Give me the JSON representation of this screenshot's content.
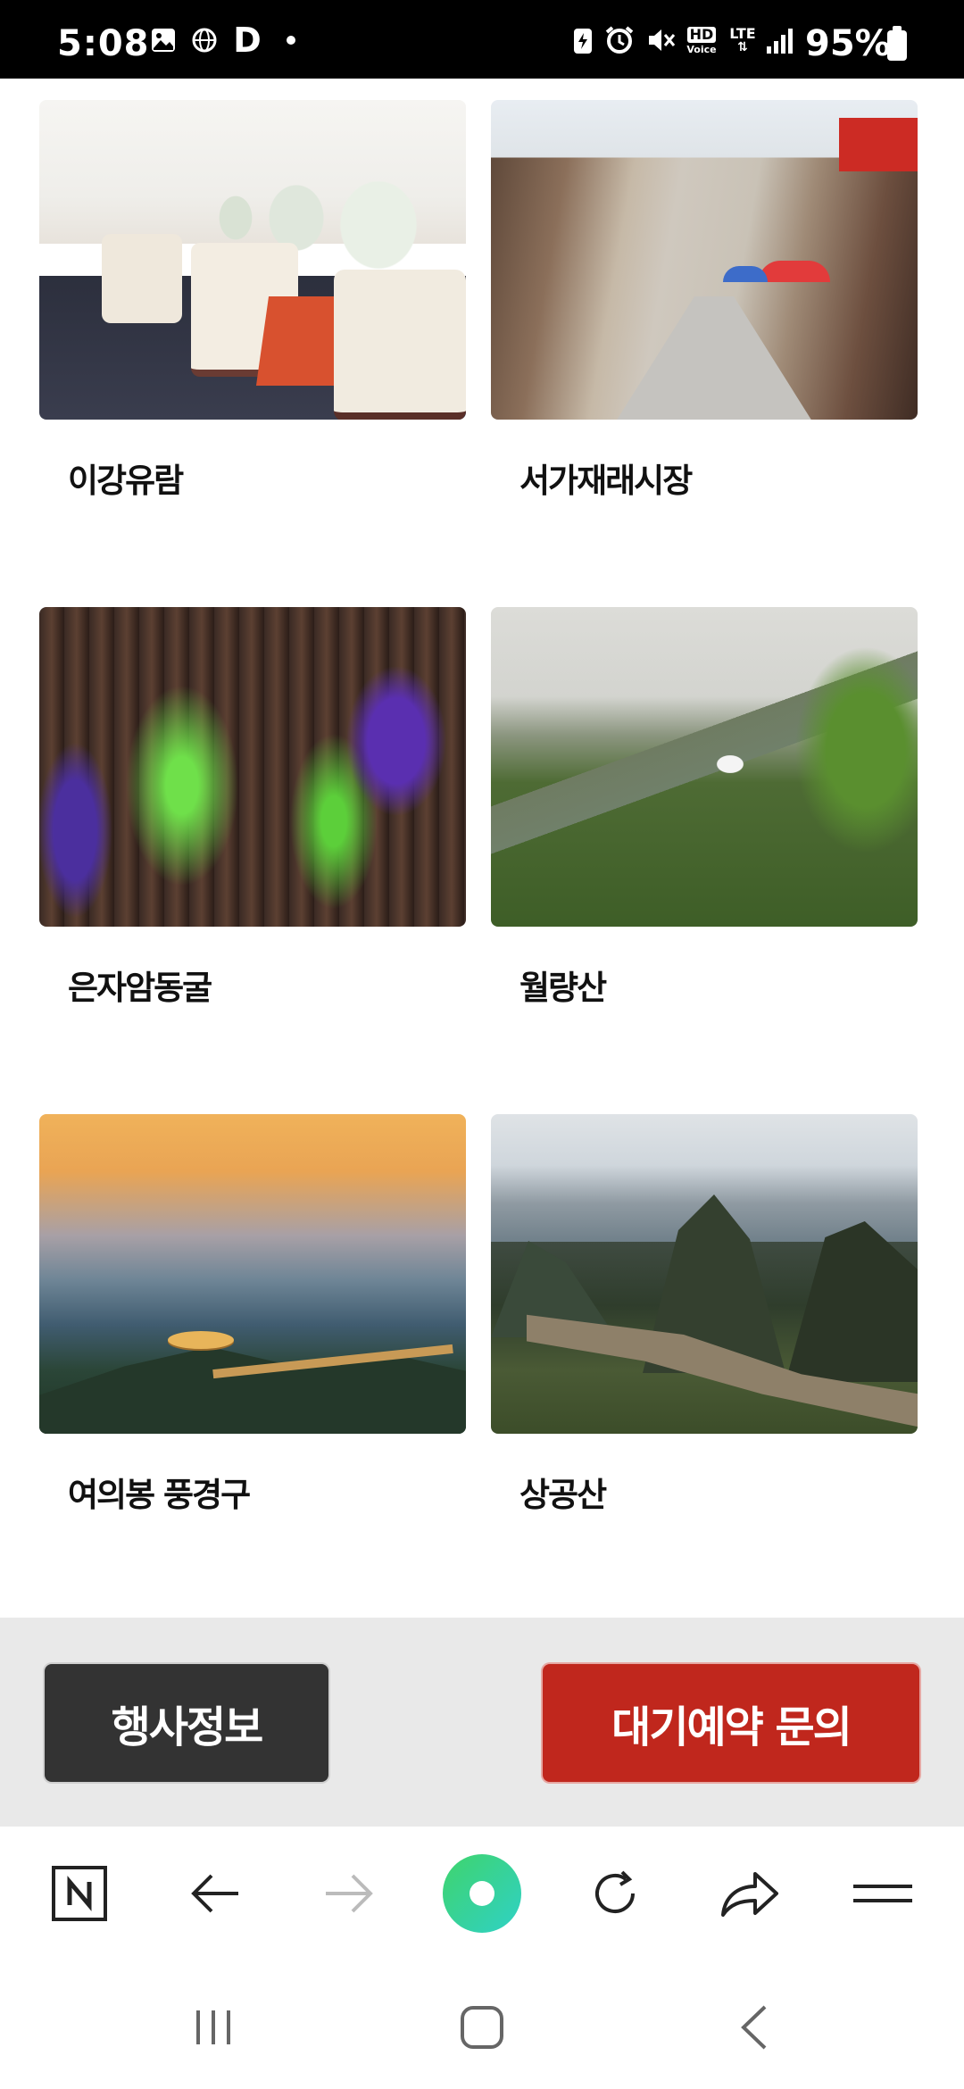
{
  "status_bar": {
    "time": "5:08",
    "battery_percent": "95%",
    "network": "LTE",
    "hd_label": "HD",
    "voice_label": "Voice",
    "d_label": "D",
    "icons": [
      "gallery-icon",
      "globe-icon",
      "dot-icon",
      "battery-saver-icon",
      "alarm-icon",
      "mute-icon",
      "hd-voice-icon",
      "lte-icon",
      "signal-icon",
      "battery-icon"
    ]
  },
  "attractions": [
    {
      "name": "이강유람",
      "photo": "boat-cruise-interior"
    },
    {
      "name": "서가재래시장",
      "photo": "west-street-market"
    },
    {
      "name": "은자암동굴",
      "photo": "cave-illuminated"
    },
    {
      "name": "월량산",
      "photo": "moon-hill"
    },
    {
      "name": "여의봉 풍경구",
      "photo": "ruyi-peak-sunset"
    },
    {
      "name": "상공산",
      "photo": "xianggong-hill-river"
    }
  ],
  "cta": {
    "info_label": "행사정보",
    "reserve_label": "대기예약 문의"
  },
  "browser_toolbar": {
    "items": [
      "naver-home-icon",
      "back-arrow-icon",
      "forward-arrow-icon",
      "green-dot-icon",
      "refresh-icon",
      "share-icon",
      "menu-icon"
    ]
  },
  "colors": {
    "reserve_button": "#c0271d",
    "info_button": "#333333",
    "cta_background": "#e9e9e9",
    "green_button": "#4fd17a"
  }
}
